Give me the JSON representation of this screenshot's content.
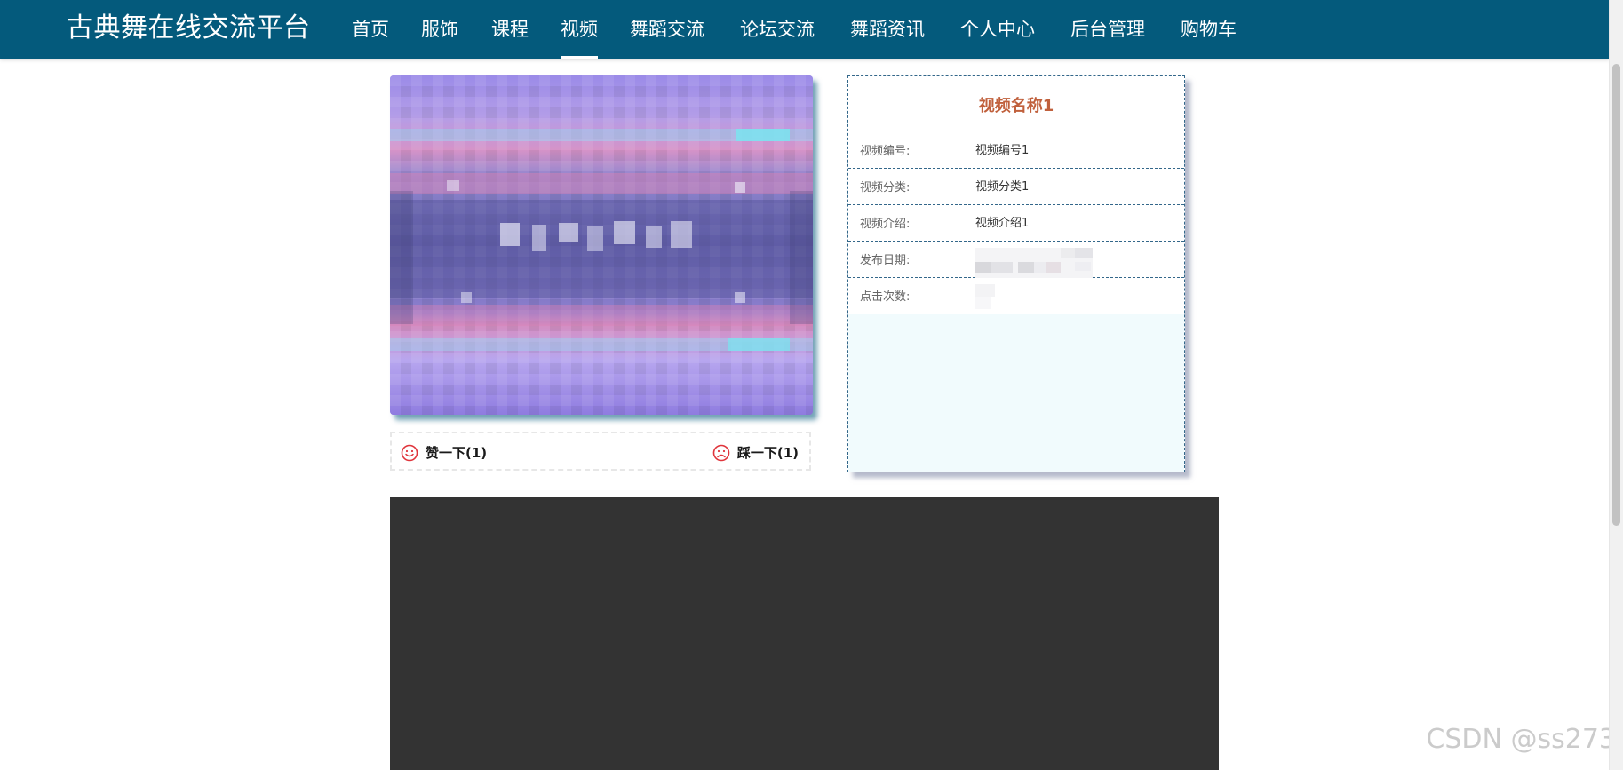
{
  "header": {
    "site_title": "古典舞在线交流平台",
    "nav": [
      {
        "label": "首页"
      },
      {
        "label": "服饰"
      },
      {
        "label": "课程"
      },
      {
        "label": "视频",
        "active": true
      },
      {
        "label": "舞蹈交流"
      },
      {
        "label": "论坛交流"
      },
      {
        "label": "舞蹈资讯"
      },
      {
        "label": "个人中心"
      },
      {
        "label": "后台管理"
      },
      {
        "label": "购物车"
      }
    ]
  },
  "video": {
    "like_label": "赞一下(1)",
    "dislike_label": "踩一下(1)",
    "like_icon": "smile-face-icon",
    "dislike_icon": "sad-face-icon"
  },
  "details": {
    "title": "视频名称1",
    "rows": [
      {
        "label": "视频编号:",
        "value": "视频编号1"
      },
      {
        "label": "视频分类:",
        "value": "视频分类1"
      },
      {
        "label": "视频介绍:",
        "value": "视频介绍1"
      },
      {
        "label": "发布日期:",
        "value": ""
      },
      {
        "label": "点击次数:",
        "value": ""
      }
    ]
  },
  "watermark": "CSDN @ss273",
  "colors": {
    "nav_background": "#045a7c",
    "title_accent": "#c0603c",
    "player_background": "#333333",
    "panel_background": "#f1fbfd"
  }
}
